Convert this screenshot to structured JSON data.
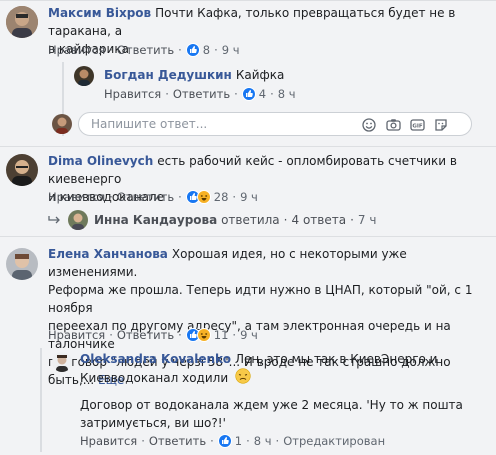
{
  "comments": [
    {
      "author": "Максим Віхров",
      "text_line1": "Почти Кафка, только превращаться будет не в таракана, а",
      "text_line2": "в кайфарика",
      "like_label": "Нравится",
      "reply_label": "Ответить",
      "reactions_count": "8",
      "time": "9 ч",
      "replies": [
        {
          "author": "Богдан Дедушкин",
          "text": "Кайфка",
          "like_label": "Нравится",
          "reply_label": "Ответить",
          "reactions_count": "4",
          "time": "8 ч"
        }
      ],
      "reply_box": {
        "placeholder": "Напишите ответ..."
      }
    },
    {
      "author": "Dima Olinevych",
      "text_line1": "есть рабочий кейс - опломбировать счетчики в киевенерго",
      "text_line2": "и киевводоканале",
      "like_label": "Нравится",
      "reply_label": "Ответить",
      "reactions_count": "28",
      "time": "9 ч",
      "thread": {
        "name": "Инна Кандаурова",
        "action": "ответила",
        "replies": "4 ответа",
        "time": "7 ч"
      }
    },
    {
      "author": "Елена Ханчанова",
      "text_line1": "Хорошая идея, но с некоторыми уже изменениями.",
      "text_line2": "Реформа же прошла. Теперь идти нужно в ЦНАП, который \"ой, с 1 ноября",
      "text_line3": "переехал по другому адресу\", а там электронная очередь и на талончике",
      "text_line4": "приговор \"людей у черзі 58\"... И вроде не так страшно должно",
      "text_line5": "быть,...",
      "more": "Еще",
      "like_label": "Нравится",
      "reply_label": "Ответить",
      "reactions_count": "11",
      "time": "9 ч",
      "replies": [
        {
          "author": "Oleksandra Kovalenko",
          "text_line1": "Лен, это мы так в КиевЭнерго и",
          "text_line2": "Киевводоканал ходили",
          "text_line3": "Договор от водоканала ждем уже 2 месяца. 'Ну то ж пошта",
          "text_line4": "затримується, ви шо?!'",
          "like_label": "Нравится",
          "reply_label": "Ответить",
          "reactions_count": "1",
          "time": "8 ч",
          "edited": "Отредактирован"
        }
      ]
    }
  ],
  "colors": {
    "link": "#385898",
    "like": "#1877f2",
    "background": "#f2f3f5"
  }
}
